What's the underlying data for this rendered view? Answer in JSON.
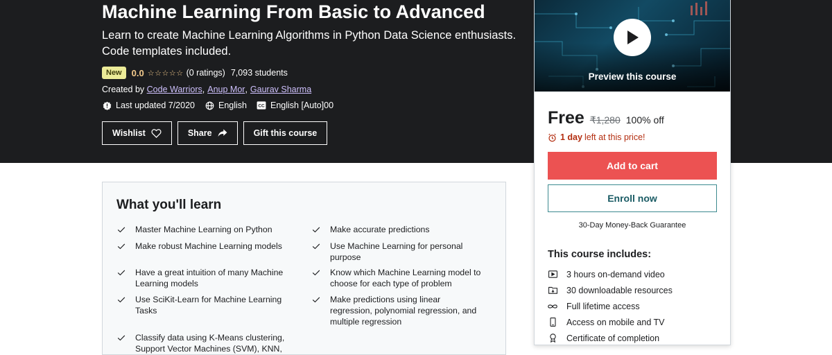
{
  "course": {
    "title": "Machine Learning From Basic to Advanced",
    "subtitle": "Learn to create Machine Learning Algorithms in Python Data Science enthusiasts. Code templates included.",
    "badge": "New",
    "rating": "0.0",
    "rating_stars": 0,
    "rating_count": "(0 ratings)",
    "students": "7,093 students",
    "created_by_label": "Created by",
    "authors": [
      "Code Warriors",
      "Anup Mor",
      "Gaurav Sharma"
    ],
    "last_updated": "Last updated 7/2020",
    "language": "English",
    "captions": "English [Auto]00"
  },
  "actions": {
    "wishlist": "Wishlist",
    "share": "Share",
    "gift": "Gift this course"
  },
  "card": {
    "preview_label": "Preview this course",
    "price": "Free",
    "original_price": "₹1,280",
    "discount": "100% off",
    "deadline_bold": "1 day",
    "deadline_rest": "left at this price!",
    "add_to_cart": "Add to cart",
    "enroll": "Enroll now",
    "guarantee": "30-Day Money-Back Guarantee",
    "includes_title": "This course includes:",
    "includes": [
      {
        "icon": "video-icon",
        "label": "3 hours on-demand video"
      },
      {
        "icon": "folder-icon",
        "label": "30 downloadable resources"
      },
      {
        "icon": "infinity-icon",
        "label": "Full lifetime access"
      },
      {
        "icon": "mobile-icon",
        "label": "Access on mobile and TV"
      },
      {
        "icon": "certificate-icon",
        "label": "Certificate of completion"
      }
    ]
  },
  "learn": {
    "title": "What you'll learn",
    "left": [
      "Master Machine Learning on Python",
      "Make robust Machine Learning models",
      "Have a great intuition of many Machine Learning models",
      "Use SciKit-Learn for Machine Learning Tasks",
      "Classify data using K-Means clustering, Support Vector Machines (SVM), KNN,"
    ],
    "right": [
      "Make accurate predictions",
      "Use Machine Learning for personal purpose",
      "Know which Machine Learning model to choose for each type of problem",
      "Make predictions using linear regression, polynomial regression, and multiple regression"
    ]
  },
  "colors": {
    "hero_bg": "#1c1d1f",
    "accent_purple_link": "#cec0fc",
    "rating_gold": "#f3ca8c",
    "cart_red": "#ec5252",
    "deadline_red": "#b32d0f",
    "enroll_teal": "#1a5b64"
  }
}
